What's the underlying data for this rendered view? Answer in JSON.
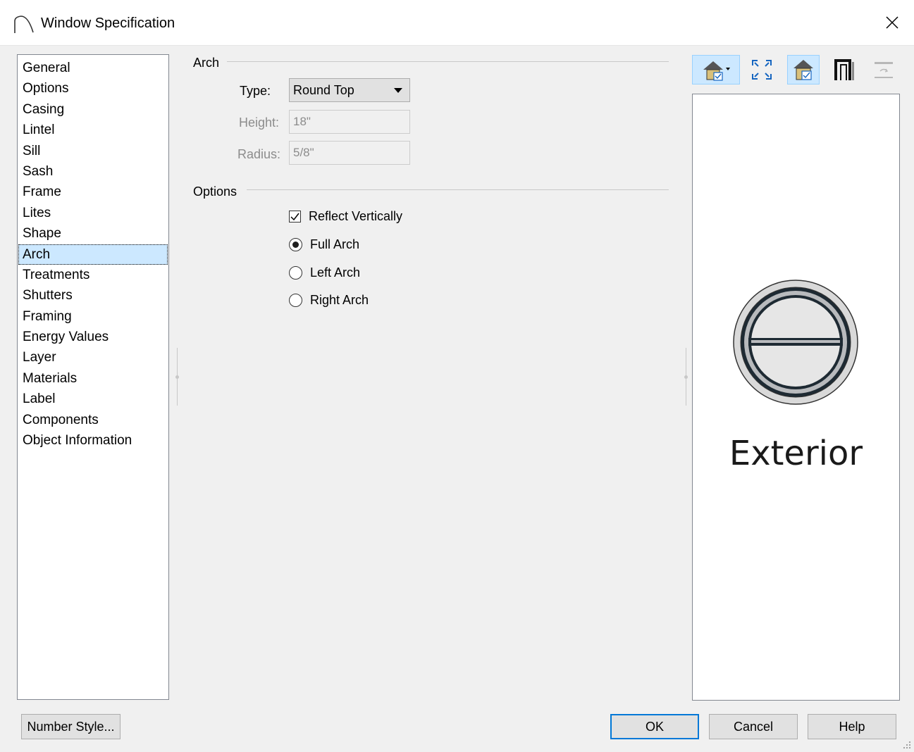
{
  "window": {
    "title": "Window Specification"
  },
  "nav": {
    "items": [
      {
        "label": "General"
      },
      {
        "label": "Options"
      },
      {
        "label": "Casing"
      },
      {
        "label": "Lintel"
      },
      {
        "label": "Sill"
      },
      {
        "label": "Sash"
      },
      {
        "label": "Frame"
      },
      {
        "label": "Lites"
      },
      {
        "label": "Shape"
      },
      {
        "label": "Arch",
        "selected": true
      },
      {
        "label": "Treatments"
      },
      {
        "label": "Shutters"
      },
      {
        "label": "Framing"
      },
      {
        "label": "Energy Values"
      },
      {
        "label": "Layer"
      },
      {
        "label": "Materials"
      },
      {
        "label": "Label"
      },
      {
        "label": "Components"
      },
      {
        "label": "Object Information"
      }
    ]
  },
  "arch": {
    "header": "Arch",
    "type_label": "Type:",
    "type_value": "Round Top",
    "height_label": "Height:",
    "height_value": "18\"",
    "radius_label": "Radius:",
    "radius_value": "5/8\""
  },
  "options": {
    "header": "Options",
    "reflect_vertically": {
      "label": "Reflect Vertically",
      "checked": true
    },
    "radios": [
      {
        "label": "Full Arch",
        "selected": true
      },
      {
        "label": "Left Arch",
        "selected": false
      },
      {
        "label": "Right Arch",
        "selected": false
      }
    ]
  },
  "preview": {
    "label": "Exterior"
  },
  "toolbar": {
    "icons": [
      "house-view-icon",
      "fill-window-icon",
      "house-check-icon",
      "door-frame-icon",
      "reverse-icon"
    ]
  },
  "buttons": {
    "number_style": "Number Style...",
    "ok": "OK",
    "cancel": "Cancel",
    "help": "Help"
  },
  "colors": {
    "selection": "#cce8ff",
    "default_button_border": "#0078d7"
  }
}
